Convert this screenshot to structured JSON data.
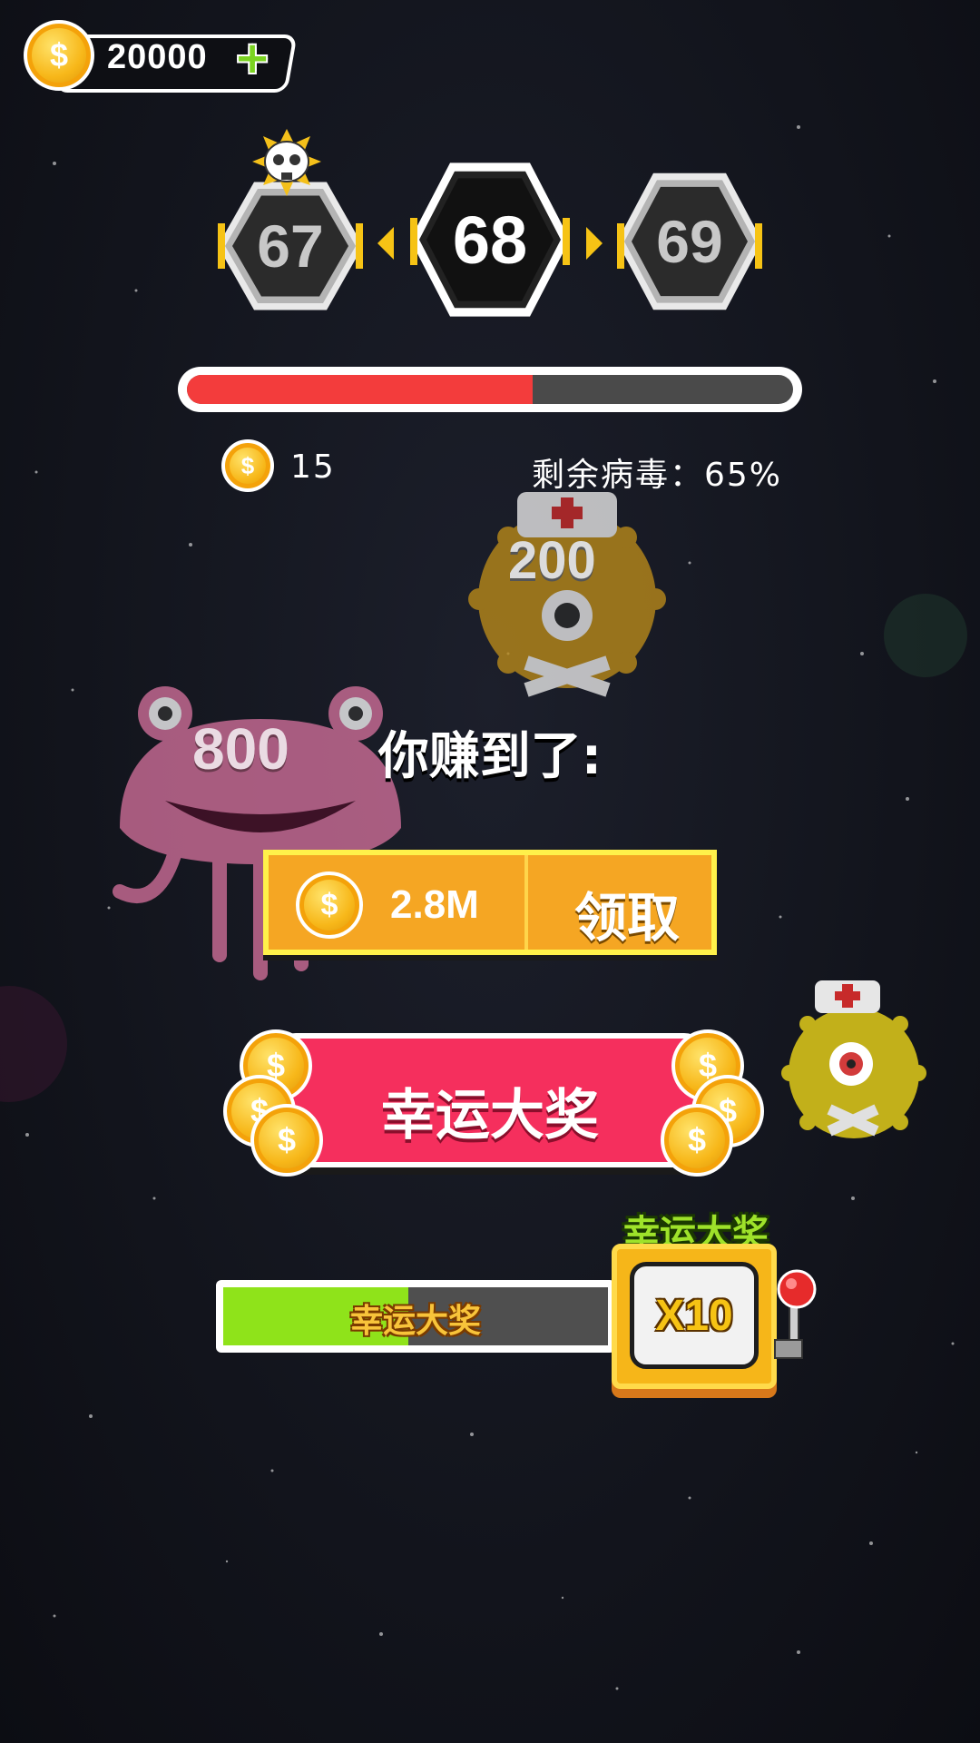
{
  "header": {
    "coins": "20000",
    "plus_icon": "plus-icon"
  },
  "levels": {
    "previous": "67",
    "current": "68",
    "next": "69"
  },
  "progress": {
    "virus_cleared_fraction": 0.57
  },
  "stats": {
    "coins_collected": "15",
    "remaining_virus": "剩余病毒：65%"
  },
  "monsters": {
    "jelly_value": "800",
    "nurse_value": "200"
  },
  "reward": {
    "title": "你赚到了:",
    "amount": "2.8M",
    "claim_label": "领取"
  },
  "lucky_button": {
    "label": "幸运大奖"
  },
  "lucky_meter": {
    "label": "幸运大奖",
    "fill_fraction": 0.48,
    "slot_title": "幸运大奖",
    "multiplier": "X10"
  },
  "colors": {
    "progress_red": "#f33c3c",
    "claim_orange": "#f5a623",
    "lucky_pink": "#f52f5d",
    "meter_green": "#8fe31a"
  }
}
